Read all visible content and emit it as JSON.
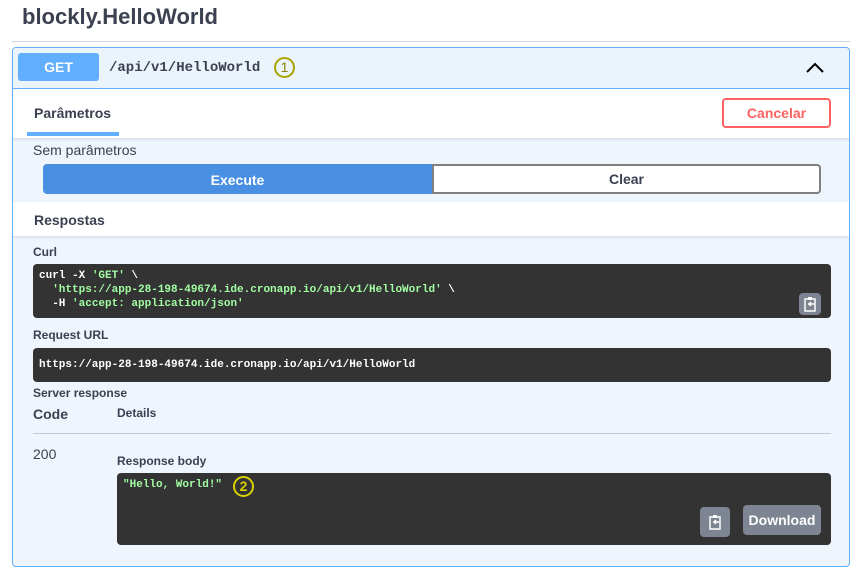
{
  "api": {
    "title": "blockly.HelloWorld"
  },
  "operation": {
    "method": "GET",
    "path": "/api/v1/HelloWorld",
    "marker": "1",
    "collapse_icon": "chevron-up-icon"
  },
  "parameters": {
    "tab_label": "Parâmetros",
    "cancel_label": "Cancelar",
    "empty_text": "Sem parâmetros",
    "execute_label": "Execute",
    "clear_label": "Clear"
  },
  "responses": {
    "header": "Respostas",
    "curl_label": "Curl",
    "curl_lines": [
      {
        "pre": "curl -X ",
        "str": "'GET'",
        "post": " \\"
      },
      {
        "pre": "  ",
        "str": "'https://app-28-198-49674.ide.cronapp.io/api/v1/HelloWorld'",
        "post": " \\"
      },
      {
        "pre": "  -H ",
        "str": "'accept: application/json'",
        "post": ""
      }
    ],
    "request_url_label": "Request URL",
    "request_url": "https://app-28-198-49674.ide.cronapp.io/api/v1/HelloWorld",
    "server_response_label": "Server response",
    "code_col": "Code",
    "details_col": "Details",
    "status_code": "200",
    "response_body_label": "Response body",
    "response_body": "\"Hello, World!\"",
    "marker": "2",
    "download_label": "Download",
    "copy_icon": "clipboard-copy-icon"
  },
  "colors": {
    "get": "#61affe",
    "execute": "#4990e2",
    "cancel": "#ff6060",
    "code_bg": "#333333",
    "string": "#a2fca2",
    "marker": "#c9c400"
  }
}
